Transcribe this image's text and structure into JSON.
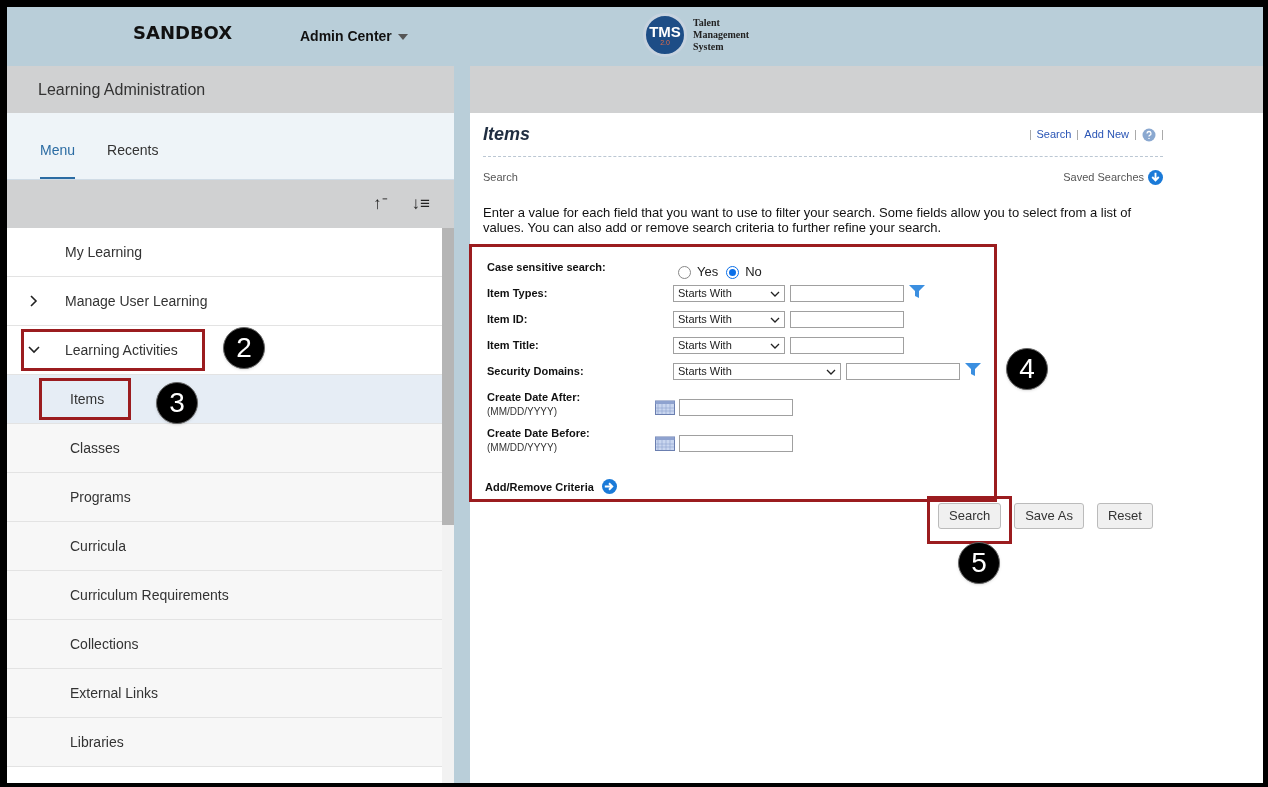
{
  "header": {
    "environment": "SANDBOX",
    "menu": "Admin Center",
    "logo_badge": "TMS",
    "logo_version": "2.0",
    "logo_text": [
      "Talent",
      "Management",
      "System"
    ]
  },
  "sidebar": {
    "title": "Learning Administration",
    "tabs": [
      {
        "label": "Menu",
        "selected": true
      },
      {
        "label": "Recents",
        "selected": false
      }
    ],
    "sort_icons": [
      "↑⁻",
      "↓≡"
    ],
    "items": [
      {
        "label": "My Learning",
        "outlined": false
      },
      {
        "label": "Manage User Learning",
        "expanded": false,
        "outlined": false
      },
      {
        "label": "Learning Activities",
        "expanded": true,
        "outlined": true,
        "children": [
          {
            "label": "Items",
            "selected": true,
            "outlined": true
          },
          {
            "label": "Classes",
            "selected": false,
            "outlined": false
          },
          {
            "label": "Programs",
            "selected": false,
            "outlined": false
          },
          {
            "label": "Curricula",
            "selected": false,
            "outlined": false
          },
          {
            "label": "Curriculum Requirements",
            "selected": false,
            "outlined": false
          },
          {
            "label": "Collections",
            "selected": false,
            "outlined": false
          },
          {
            "label": "External Links",
            "selected": false,
            "outlined": false
          },
          {
            "label": "Libraries",
            "selected": false,
            "outlined": false
          }
        ]
      }
    ]
  },
  "page": {
    "title": "Items",
    "links": [
      "Search",
      "Add New"
    ],
    "section": "Search",
    "saved_searches": "Saved Searches",
    "intro": "Enter a value for each field that you want to use to filter your search. Some fields allow you to select from a list of values. You can also add or remove search criteria to further refine your search.",
    "form": {
      "outlined": true,
      "fields": [
        {
          "kind": "radio",
          "label": "Case sensitive search:",
          "options": [
            {
              "label": "Yes",
              "selected": false
            },
            {
              "label": "No",
              "selected": true
            }
          ]
        },
        {
          "kind": "match",
          "label": "Item Types:",
          "operator": "Starts With",
          "filter": true,
          "wide": false
        },
        {
          "kind": "match",
          "label": "Item ID:",
          "operator": "Starts With",
          "filter": false,
          "wide": false
        },
        {
          "kind": "match",
          "label": "Item Title:",
          "operator": "Starts With",
          "filter": false,
          "wide": false
        },
        {
          "kind": "match",
          "label": "Security Domains:",
          "operator": "Starts With",
          "filter": true,
          "wide": true
        },
        {
          "kind": "date",
          "label": "Create Date After:",
          "hint": "(MM/DD/YYYY)"
        },
        {
          "kind": "date",
          "label": "Create Date Before:",
          "hint": "(MM/DD/YYYY)"
        }
      ],
      "add_remove": "Add/Remove Criteria"
    },
    "buttons": [
      {
        "label": "Search",
        "outlined": true
      },
      {
        "label": "Save As",
        "outlined": false
      },
      {
        "label": "Reset",
        "outlined": false
      }
    ]
  },
  "callouts": [
    "2",
    "3",
    "4",
    "5"
  ]
}
